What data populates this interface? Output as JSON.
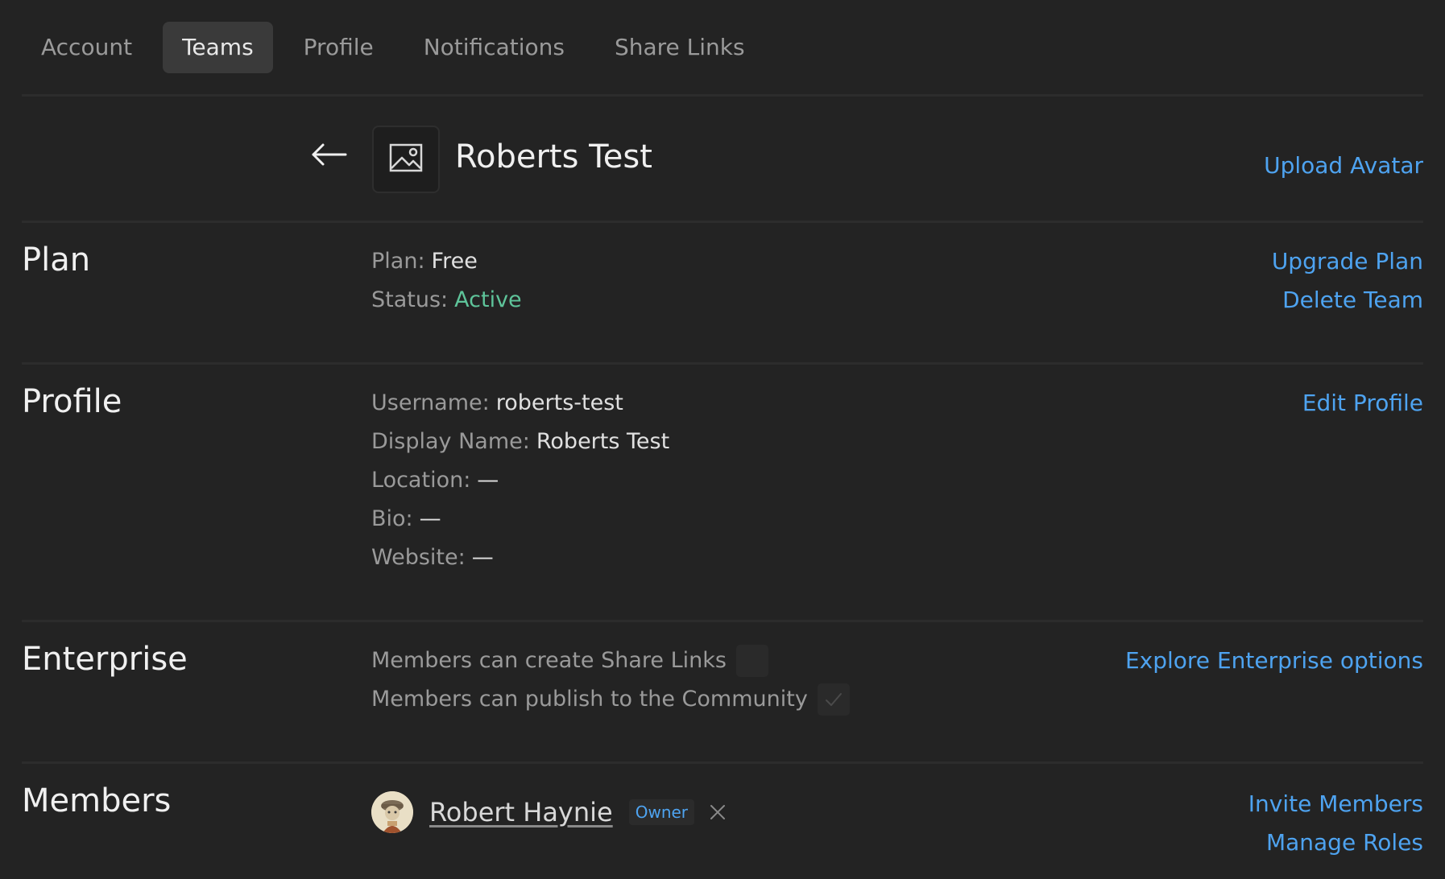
{
  "tabs": [
    {
      "label": "Account",
      "active": false
    },
    {
      "label": "Teams",
      "active": true
    },
    {
      "label": "Profile",
      "active": false
    },
    {
      "label": "Notifications",
      "active": false
    },
    {
      "label": "Share Links",
      "active": false
    }
  ],
  "team": {
    "name": "Roberts Test",
    "upload_avatar_label": "Upload Avatar",
    "back_icon": "arrow-left-icon",
    "avatar_placeholder_icon": "image-icon"
  },
  "plan": {
    "title": "Plan",
    "plan_label": "Plan:",
    "plan_value": "Free",
    "status_label": "Status:",
    "status_value": "Active",
    "upgrade_label": "Upgrade Plan",
    "delete_label": "Delete Team"
  },
  "profile": {
    "title": "Profile",
    "username_label": "Username:",
    "username_value": "roberts-test",
    "display_name_label": "Display Name:",
    "display_name_value": "Roberts Test",
    "location_label": "Location:",
    "location_value": "—",
    "bio_label": "Bio:",
    "bio_value": "—",
    "website_label": "Website:",
    "website_value": "—",
    "edit_label": "Edit Profile"
  },
  "enterprise": {
    "title": "Enterprise",
    "share_links_label": "Members can create Share Links",
    "share_links_checked": false,
    "publish_label": "Members can publish to the Community",
    "publish_checked": true,
    "explore_label": "Explore Enterprise options"
  },
  "members": {
    "title": "Members",
    "list": [
      {
        "name": "Robert Haynie",
        "role": "Owner"
      }
    ],
    "invite_label": "Invite Members",
    "manage_roles_label": "Manage Roles"
  },
  "colors": {
    "background": "#232323",
    "link": "#4ea3f0",
    "status_active": "#5ec49a",
    "divider": "#2c2c2c"
  }
}
